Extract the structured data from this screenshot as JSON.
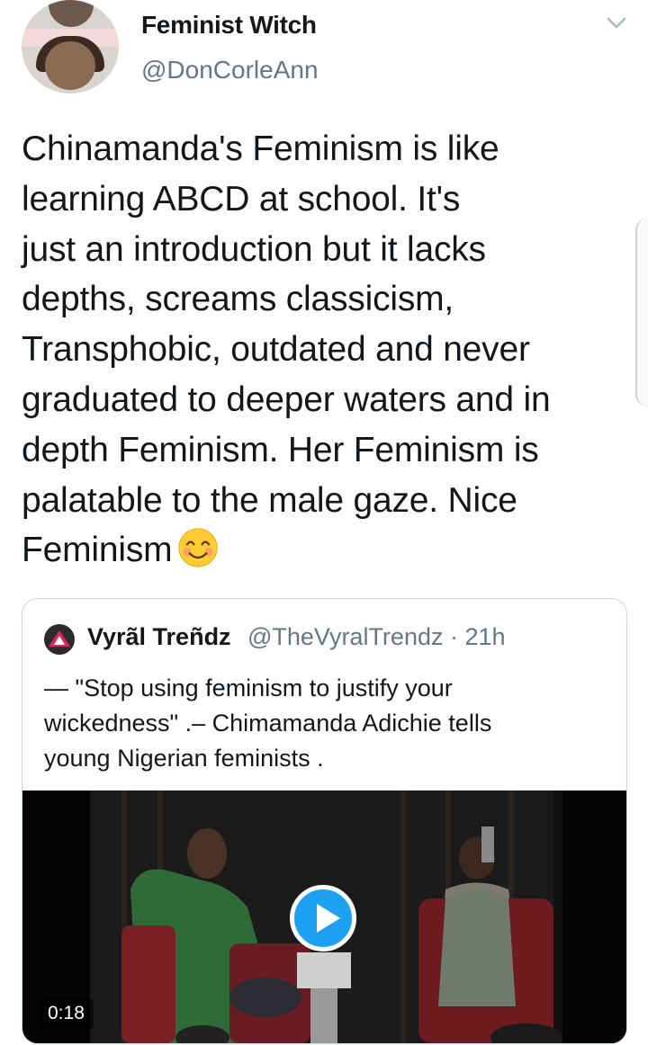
{
  "tweet": {
    "display_name": "Feminist Witch",
    "handle": "@DonCorleAnn",
    "text": "Chinamanda's Feminism is like\nlearning ABCD at school. It's\njust an introduction but it lacks\ndepths, screams classicism,\nTransphobic, outdated and never\ngraduated to deeper waters and in\ndepth Feminism. Her Feminism is\npalatable to the male gaze. Nice\nFeminism",
    "emoji": "smiling-face-with-smiling-eyes"
  },
  "quoted_tweet": {
    "display_name": "Vyrãl Treñdz",
    "handle": "@TheVyralTrendz",
    "separator": "·",
    "time": "21h",
    "text": "— \"Stop using feminism to justify your\nwickedness\" .–  Chimamanda Adichie  tells\nyoung Nigerian feminists .",
    "video": {
      "duration": "0:18",
      "play_icon": "play-icon"
    }
  },
  "colors": {
    "text_primary": "#14171a",
    "text_secondary": "#657786",
    "accent": "#1da1f2",
    "border": "#ccd6dd"
  }
}
